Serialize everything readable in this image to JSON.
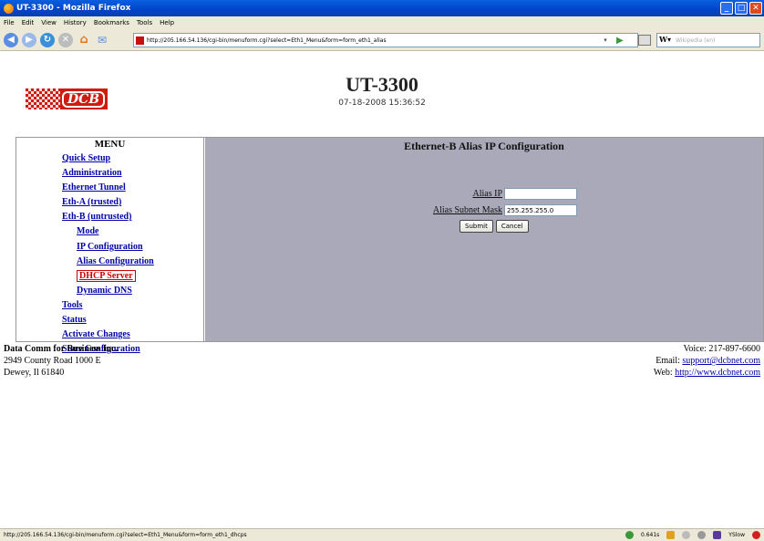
{
  "window": {
    "title": "UT-3300 - Mozilla Firefox"
  },
  "menubar": [
    "File",
    "Edit",
    "View",
    "History",
    "Bookmarks",
    "Tools",
    "Help"
  ],
  "navbar": {
    "url": "http://205.166.54.136/cgi-bin/menuform.cgi?select=Eth1_Menu&form=form_eth1_alias",
    "search_placeholder": "Wikipedia (en)"
  },
  "header": {
    "logo_text": "DCB",
    "title": "UT-3300",
    "datetime": "07-18-2008 15:36:52"
  },
  "menu": {
    "title": "MENU",
    "items": [
      {
        "label": "Quick Setup",
        "level": 0
      },
      {
        "label": "Administration",
        "level": 0
      },
      {
        "label": "Ethernet Tunnel",
        "level": 0
      },
      {
        "label": "Eth-A (trusted)",
        "level": 0
      },
      {
        "label": "Eth-B (untrusted)",
        "level": 0
      },
      {
        "label": "Mode",
        "level": 1
      },
      {
        "label": "IP Configuration",
        "level": 1
      },
      {
        "label": "Alias Configuration",
        "level": 1
      },
      {
        "label": "DHCP Server",
        "level": 1,
        "active": true
      },
      {
        "label": "Dynamic DNS",
        "level": 1
      },
      {
        "label": "Tools",
        "level": 0
      },
      {
        "label": "Status",
        "level": 0
      },
      {
        "label": "Activate Changes",
        "level": 0
      },
      {
        "label": "Store Configuration",
        "level": 0
      }
    ]
  },
  "form": {
    "title": "Ethernet-B Alias IP Configuration",
    "alias_ip_label": "Alias IP",
    "alias_ip_value": "",
    "alias_mask_label": "Alias Subnet Mask",
    "alias_mask_value": "255.255.255.0",
    "submit_label": "Submit",
    "cancel_label": "Cancel"
  },
  "footer": {
    "company": "Data Comm for Business Inc.",
    "address1": "2949 County Road 1000 E",
    "address2": "Dewey, Il 61840",
    "voice": "Voice: 217-897-6600",
    "email_label": "Email:",
    "email": "support@dcbnet.com",
    "web_label": "Web:",
    "web": "http://www.dcbnet.com"
  },
  "statusbar": {
    "text": "http://205.166.54.136/cgi-bin/menuform.cgi?select=Eth1_Menu&form=form_eth1_dhcps",
    "timing": "0.641s",
    "yslow": "YSlow"
  }
}
